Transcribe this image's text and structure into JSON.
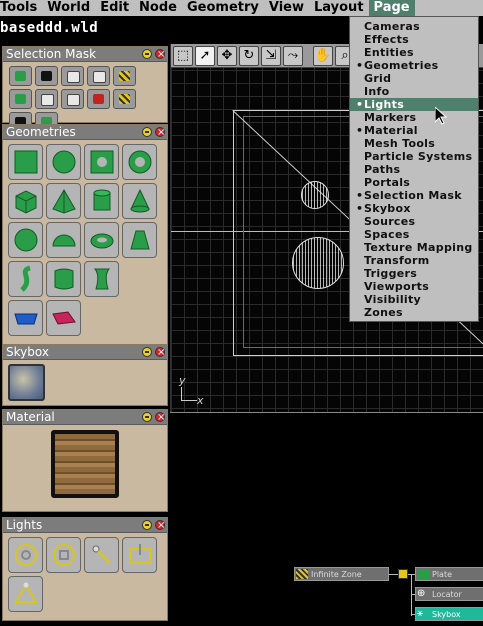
{
  "menubar": {
    "items": [
      "Tools",
      "World",
      "Edit",
      "Node",
      "Geometry",
      "View",
      "Layout",
      "Page"
    ],
    "active_index": 7
  },
  "window": {
    "title": "baseddd.wld"
  },
  "panels": {
    "selection_mask": {
      "title": "Selection Mask"
    },
    "geometries": {
      "title": "Geometries"
    },
    "skybox": {
      "title": "Skybox"
    },
    "material": {
      "title": "Material"
    },
    "lights": {
      "title": "Lights"
    }
  },
  "page_menu": {
    "items": [
      {
        "label": "Cameras",
        "bullet": false
      },
      {
        "label": "Effects",
        "bullet": false
      },
      {
        "label": "Entities",
        "bullet": false
      },
      {
        "label": "Geometries",
        "bullet": true
      },
      {
        "label": "Grid",
        "bullet": false
      },
      {
        "label": "Info",
        "bullet": false
      },
      {
        "label": "Lights",
        "bullet": true,
        "highlighted": true
      },
      {
        "label": "Markers",
        "bullet": false
      },
      {
        "label": "Material",
        "bullet": true
      },
      {
        "label": "Mesh Tools",
        "bullet": false
      },
      {
        "label": "Particle Systems",
        "bullet": false
      },
      {
        "label": "Paths",
        "bullet": false
      },
      {
        "label": "Portals",
        "bullet": false
      },
      {
        "label": "Selection Mask",
        "bullet": true
      },
      {
        "label": "Skybox",
        "bullet": true
      },
      {
        "label": "Sources",
        "bullet": false
      },
      {
        "label": "Spaces",
        "bullet": false
      },
      {
        "label": "Texture Mapping",
        "bullet": false
      },
      {
        "label": "Transform",
        "bullet": false
      },
      {
        "label": "Triggers",
        "bullet": false
      },
      {
        "label": "Viewports",
        "bullet": false
      },
      {
        "label": "Visibility",
        "bullet": false
      },
      {
        "label": "Zones",
        "bullet": false
      }
    ]
  },
  "viewport": {
    "axis_x": "x",
    "axis_y": "y"
  },
  "scene_graph": {
    "nodes": [
      "Infinite Zone",
      "Plate",
      "Locator",
      "Skybox"
    ]
  },
  "colors": {
    "menu_highlight": "#4f7f6d",
    "panel_bg": "#c9b9a0",
    "geometry_green": "#2a9d48"
  }
}
